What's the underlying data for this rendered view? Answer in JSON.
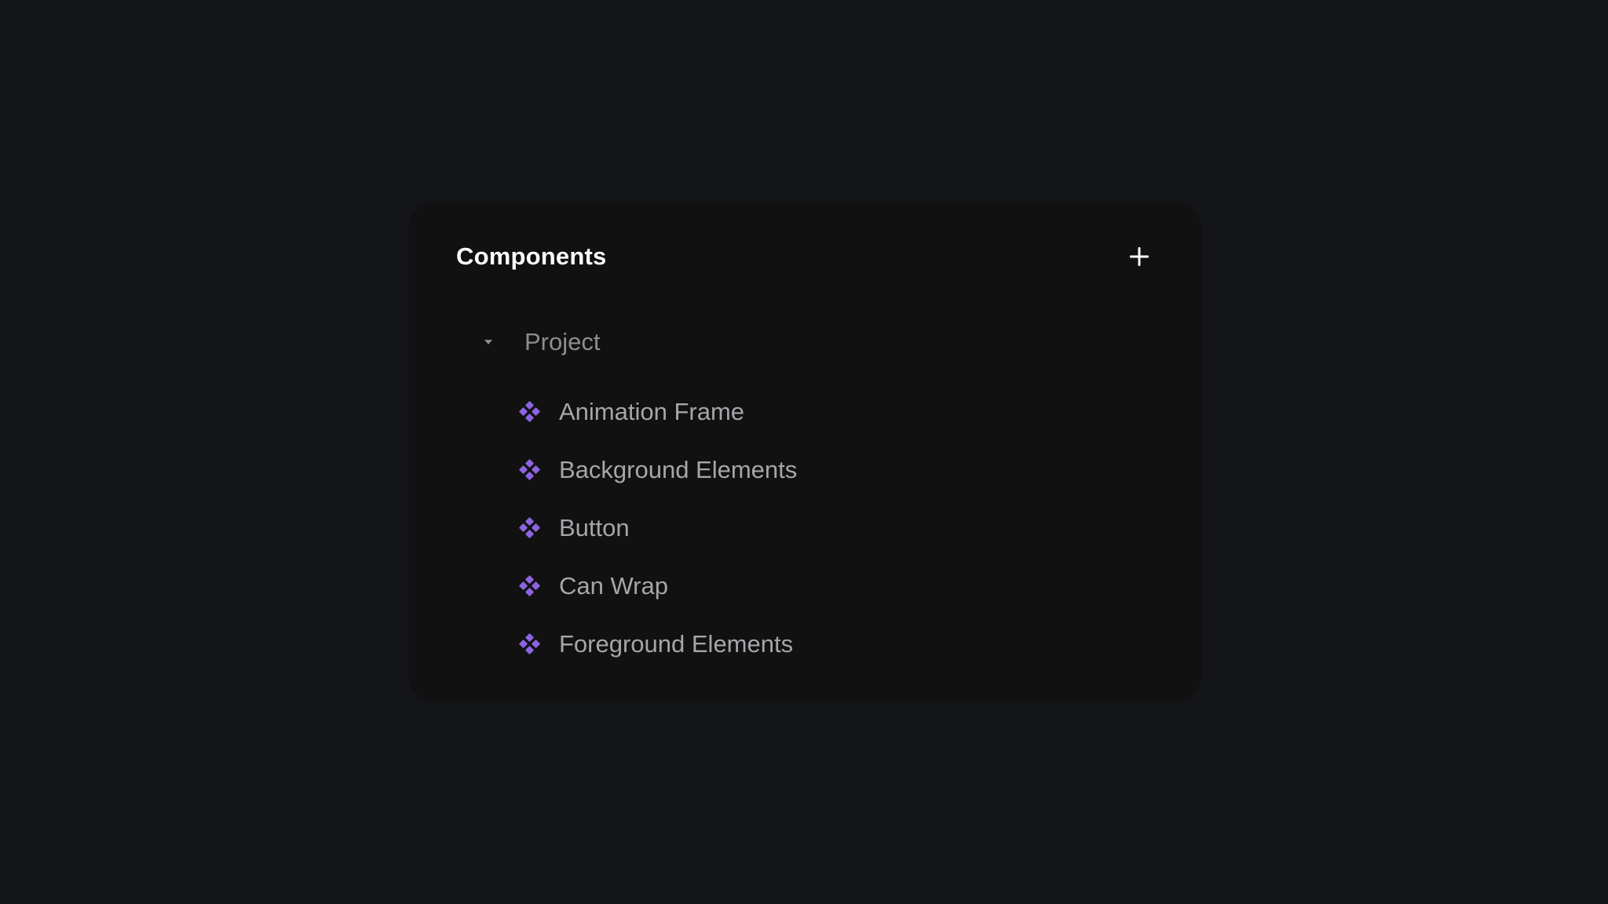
{
  "panel": {
    "title": "Components",
    "add_icon": "plus-icon"
  },
  "tree": {
    "folder": {
      "label": "Project",
      "expanded": true,
      "caret_icon": "caret-down-icon"
    },
    "items": [
      {
        "label": "Animation Frame",
        "icon": "component-icon"
      },
      {
        "label": "Background Elements",
        "icon": "component-icon"
      },
      {
        "label": "Button",
        "icon": "component-icon"
      },
      {
        "label": "Can Wrap",
        "icon": "component-icon"
      },
      {
        "label": "Foreground Elements",
        "icon": "component-icon"
      }
    ]
  },
  "colors": {
    "background": "#141518",
    "panel": "#111112",
    "accent": "#8c63e0",
    "title": "#ffffff",
    "item_text": "#a6a6aa",
    "folder_text": "#8d8d92"
  }
}
